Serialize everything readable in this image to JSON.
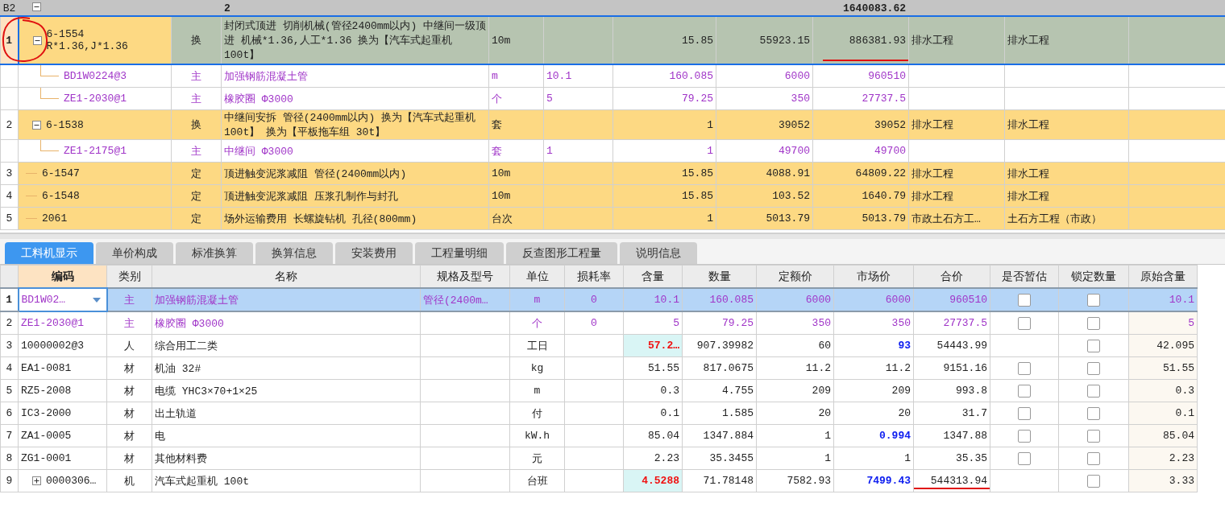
{
  "summary": {
    "label": "B2",
    "expanded": true,
    "code": "2",
    "total": "1640083.62"
  },
  "items": [
    {
      "num": "1",
      "selected": true,
      "circled": true,
      "expanded": true,
      "code": "6-1554",
      "code_note": "R*1.36,J*1.36",
      "type": "换",
      "name": "封闭式顶进 切削机械(管径2400mm以内)  中继间一级顶进 机械*1.36,人工*1.36  换为【汽车式起重机 100t】",
      "unit": "10m",
      "quantity": "15.85",
      "unit_price": "55923.15",
      "total": "886381.93",
      "total_underlined": true,
      "column_9": "排水工程",
      "column_10": "排水工程",
      "children": [
        {
          "code": "BD1W0224@3",
          "type": "主",
          "name": "加强钢筋混凝土管",
          "unit": "m",
          "content": "10.1",
          "quantity": "160.085",
          "unit_price": "6000",
          "total": "960510"
        },
        {
          "code": "ZE1-2030@1",
          "type": "主",
          "name": "橡胶圈 Φ3000",
          "unit": "个",
          "content": "5",
          "quantity": "79.25",
          "unit_price": "350",
          "total": "27737.5"
        }
      ]
    },
    {
      "num": "2",
      "selected": false,
      "circled": false,
      "expanded": true,
      "code": "6-1538",
      "type": "换",
      "name": "中继间安拆 管径(2400mm以内)  换为【汽车式起重机 100t】  换为【平板拖车组 30t】",
      "unit": "套",
      "quantity": "1",
      "unit_price": "39052",
      "total": "39052",
      "total_underlined": false,
      "column_9": "排水工程",
      "column_10": "排水工程",
      "children": [
        {
          "code": "ZE1-2175@1",
          "type": "主",
          "name": "中继间 Φ3000",
          "unit": "套",
          "content": "1",
          "quantity": "1",
          "unit_price": "49700",
          "total": "49700"
        }
      ]
    },
    {
      "num": "3",
      "selected": false,
      "circled": false,
      "code": "6-1547",
      "type": "定",
      "name": "顶进触变泥浆减阻 管径(2400mm以内)",
      "unit": "10m",
      "quantity": "15.85",
      "unit_price": "4088.91",
      "total": "64809.22",
      "total_underlined": false,
      "column_9": "排水工程",
      "column_10": "排水工程"
    },
    {
      "num": "4",
      "selected": false,
      "circled": false,
      "code": "6-1548",
      "type": "定",
      "name": "顶进触变泥浆减阻 压浆孔制作与封孔",
      "unit": "10m",
      "quantity": "15.85",
      "unit_price": "103.52",
      "total": "1640.79",
      "total_underlined": false,
      "column_9": "排水工程",
      "column_10": "排水工程"
    },
    {
      "num": "5",
      "selected": false,
      "circled": false,
      "code": "2061",
      "type": "定",
      "name": "场外运输费用 长螺旋钻机 孔径(800mm)",
      "unit": "台次",
      "quantity": "1",
      "unit_price": "5013.79",
      "total": "5013.79",
      "total_underlined": false,
      "column_9": "市政土石方工…",
      "column_10": "土石方工程（市政）"
    }
  ],
  "tabs": [
    {
      "label": "工料机显示",
      "selected": true
    },
    {
      "label": "单价构成",
      "selected": false
    },
    {
      "label": "标准换算",
      "selected": false
    },
    {
      "label": "换算信息",
      "selected": false
    },
    {
      "label": "安装费用",
      "selected": false
    },
    {
      "label": "工程量明细",
      "selected": false
    },
    {
      "label": "反查图形工程量",
      "selected": false
    },
    {
      "label": "说明信息",
      "selected": false
    }
  ],
  "resources": {
    "columns": [
      "编码",
      "类别",
      "名称",
      "规格及型号",
      "单位",
      "损耗率",
      "含量",
      "数量",
      "定额价",
      "市场价",
      "合价",
      "是否暂估",
      "锁定数量",
      "原始含量"
    ],
    "rows": [
      {
        "num": "1",
        "selected": true,
        "kind": "main",
        "code": "BD1W02…",
        "type": "主",
        "name": "加强钢筋混凝土管",
        "spec": "管径(2400m…",
        "unit": "m",
        "loss": "0",
        "content": "10.1",
        "content_changed": false,
        "quantity": "160.085",
        "quota_price": "6000",
        "market_price": "6000",
        "price_changed": false,
        "total": "960510",
        "total_underlined": false,
        "estimate": {
          "checked": false
        },
        "lock": {
          "checked": false
        },
        "original": "10.1"
      },
      {
        "num": "2",
        "selected": false,
        "kind": "main",
        "code": "ZE1-2030@1",
        "type": "主",
        "name": "橡胶圈 Φ3000",
        "unit": "个",
        "loss": "0",
        "content": "5",
        "content_changed": false,
        "quantity": "79.25",
        "quota_price": "350",
        "market_price": "350",
        "price_changed": false,
        "total": "27737.5",
        "total_underlined": false,
        "estimate": {
          "checked": false
        },
        "lock": {
          "checked": false
        },
        "original": "5"
      },
      {
        "num": "3",
        "selected": false,
        "kind": "normal",
        "code": "10000002@3",
        "type": "人",
        "name": "综合用工二类",
        "unit": "工日",
        "content": "57.2…",
        "content_changed": true,
        "quantity": "907.39982",
        "quota_price": "60",
        "market_price": "93",
        "price_changed": true,
        "total": "54443.99",
        "total_underlined": false,
        "lock": {
          "checked": false
        },
        "original": "42.095"
      },
      {
        "num": "4",
        "selected": false,
        "kind": "normal",
        "code": "EA1-0081",
        "type": "材",
        "name": "机油 32#",
        "unit": "kg",
        "content": "51.55",
        "content_changed": false,
        "quantity": "817.0675",
        "quota_price": "11.2",
        "market_price": "11.2",
        "price_changed": false,
        "total": "9151.16",
        "total_underlined": false,
        "estimate": {
          "checked": false
        },
        "lock": {
          "checked": false
        },
        "original": "51.55"
      },
      {
        "num": "5",
        "selected": false,
        "kind": "normal",
        "code": "RZ5-2008",
        "type": "材",
        "name": "电缆 YHC3×70+1×25",
        "unit": "m",
        "content": "0.3",
        "content_changed": false,
        "quantity": "4.755",
        "quota_price": "209",
        "market_price": "209",
        "price_changed": false,
        "total": "993.8",
        "total_underlined": false,
        "estimate": {
          "checked": false
        },
        "lock": {
          "checked": false
        },
        "original": "0.3"
      },
      {
        "num": "6",
        "selected": false,
        "kind": "normal",
        "code": "IC3-2000",
        "type": "材",
        "name": "出土轨道",
        "unit": "付",
        "content": "0.1",
        "content_changed": false,
        "quantity": "1.585",
        "quota_price": "20",
        "market_price": "20",
        "price_changed": false,
        "total": "31.7",
        "total_underlined": false,
        "estimate": {
          "checked": false
        },
        "lock": {
          "checked": false
        },
        "original": "0.1"
      },
      {
        "num": "7",
        "selected": false,
        "kind": "normal",
        "code": "ZA1-0005",
        "type": "材",
        "name": "电",
        "unit": "kW.h",
        "content": "85.04",
        "content_changed": false,
        "quantity": "1347.884",
        "quota_price": "1",
        "market_price": "0.994",
        "price_changed": true,
        "total": "1347.88",
        "total_underlined": false,
        "estimate": {
          "checked": false
        },
        "lock": {
          "checked": false
        },
        "original": "85.04"
      },
      {
        "num": "8",
        "selected": false,
        "kind": "normal",
        "code": "ZG1-0001",
        "type": "材",
        "name": "其他材料费",
        "unit": "元",
        "content": "2.23",
        "content_changed": false,
        "quantity": "35.3455",
        "quota_price": "1",
        "market_price": "1",
        "price_changed": false,
        "total": "35.35",
        "total_underlined": false,
        "estimate": {
          "checked": false
        },
        "lock": {
          "checked": false
        },
        "original": "2.23"
      },
      {
        "num": "9",
        "selected": false,
        "kind": "normal",
        "expanded": false,
        "code": "0000306…",
        "type": "机",
        "name": "汽车式起重机 100t",
        "unit": "台班",
        "content": "4.5288",
        "content_changed": true,
        "quantity": "71.78148",
        "quota_price": "7582.93",
        "market_price": "7499.43",
        "price_changed": true,
        "total": "544313.94",
        "total_underlined": true,
        "lock": {
          "checked": false
        },
        "original": "3.33"
      }
    ]
  }
}
